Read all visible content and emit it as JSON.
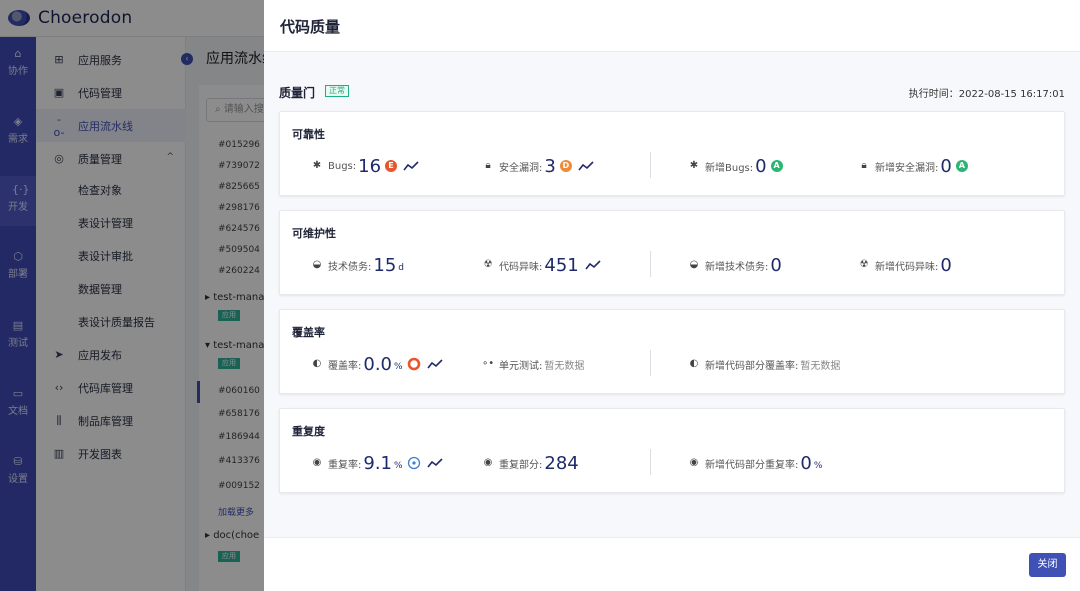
{
  "app": {
    "name": "Choerodon"
  },
  "rail": [
    {
      "label": "协作",
      "icon": "collab-icon"
    },
    {
      "label": "需求",
      "icon": "layers-icon"
    },
    {
      "label": "开发",
      "icon": "code-icon"
    },
    {
      "label": "部署",
      "icon": "deploy-icon"
    },
    {
      "label": "测试",
      "icon": "clipboard-icon"
    },
    {
      "label": "文档",
      "icon": "doc-icon"
    },
    {
      "label": "设置",
      "icon": "settings-icon"
    }
  ],
  "subnav": [
    {
      "label": "应用服务",
      "icon": "grid-icon"
    },
    {
      "label": "代码管理",
      "icon": "code-box-icon"
    },
    {
      "label": "应用流水线",
      "icon": "pipeline-icon"
    },
    {
      "label": "质量管理",
      "icon": "shield-icon"
    },
    {
      "label": "检查对象"
    },
    {
      "label": "表设计管理"
    },
    {
      "label": "表设计审批"
    },
    {
      "label": "数据管理"
    },
    {
      "label": "表设计质量报告"
    },
    {
      "label": "应用发布",
      "icon": "send-icon"
    },
    {
      "label": "代码库管理",
      "icon": "brackets-icon"
    },
    {
      "label": "制品库管理",
      "icon": "artifact-icon"
    },
    {
      "label": "开发图表",
      "icon": "chart-icon"
    }
  ],
  "page": {
    "title": "应用流水线",
    "search_placeholder": "请输入搜",
    "commits_a": [
      "#015296",
      "#739072",
      "#825665",
      "#298176",
      "#624576",
      "#509504",
      "#260224"
    ],
    "group_b": "test-mana",
    "group_c": "test-mana",
    "commits_b": [
      "#060160",
      "#658176",
      "#186944",
      "#413376",
      "#009152"
    ],
    "load_more": "加载更多",
    "group_d": "doc(choe",
    "tag_app": "应用",
    "tag_status": "成"
  },
  "drawer": {
    "title": "代码质量",
    "gate_label": "质量门",
    "gate_status": "正常",
    "exec_time": "执行时间：2022-08-15 16:17:01",
    "close_label": "关闭",
    "reliability": {
      "title": "可靠性",
      "bugs_label": "Bugs:",
      "bugs_value": "16",
      "bugs_grade": "E",
      "vuln_label": "安全漏洞:",
      "vuln_value": "3",
      "vuln_grade": "D",
      "new_bugs_label": "新增Bugs:",
      "new_bugs_value": "0",
      "new_bugs_grade": "A",
      "new_vuln_label": "新增安全漏洞:",
      "new_vuln_value": "0",
      "new_vuln_grade": "A"
    },
    "maintainability": {
      "title": "可维护性",
      "debt_label": "技术债务:",
      "debt_value": "15",
      "debt_unit": "d",
      "smell_label": "代码异味:",
      "smell_value": "451",
      "new_debt_label": "新增技术债务:",
      "new_debt_value": "0",
      "new_smell_label": "新增代码异味:",
      "new_smell_value": "0"
    },
    "coverage": {
      "title": "覆盖率",
      "cov_label": "覆盖率:",
      "cov_value": "0.0",
      "cov_unit": "%",
      "unit_label": "单元测试:",
      "unit_value": "暂无数据",
      "new_cov_label": "新增代码部分覆盖率:",
      "new_cov_value": "暂无数据"
    },
    "duplication": {
      "title": "重复度",
      "dup_label": "重复率:",
      "dup_value": "9.1",
      "dup_unit": "%",
      "blocks_label": "重复部分:",
      "blocks_value": "284",
      "new_dup_label": "新增代码部分重复率:",
      "new_dup_value": "0",
      "new_dup_unit": "%"
    }
  },
  "colors": {
    "primary": "#3f51b5",
    "grade_e": "#e8562a",
    "grade_d": "#ef8a3a",
    "grade_a": "#2bb673",
    "ok": "#1fae83"
  }
}
